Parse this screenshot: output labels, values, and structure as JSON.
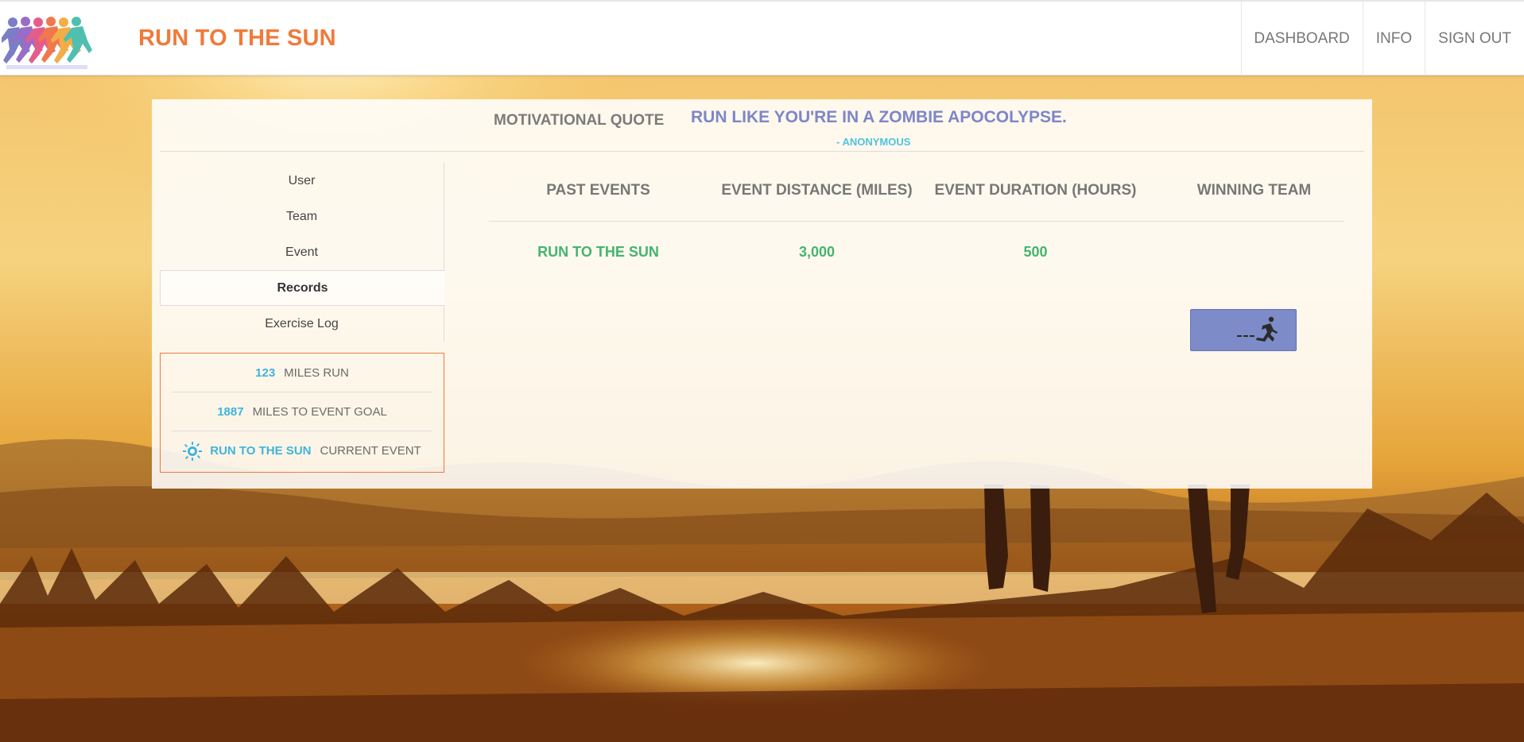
{
  "header": {
    "brand": "RUN TO THE SUN",
    "logo_icon": "runners-logo-icon",
    "nav": [
      "DASHBOARD",
      "INFO",
      "SIGN OUT"
    ]
  },
  "quote": {
    "label": "MOTIVATIONAL QUOTE",
    "text": "RUN LIKE YOU'RE IN A ZOMBIE APOCOLYPSE.",
    "author": "- ANONYMOUS"
  },
  "sidenav": {
    "items": [
      "User",
      "Team",
      "Event",
      "Records",
      "Exercise Log"
    ],
    "active": "Records"
  },
  "stats": {
    "miles_run": "123",
    "miles_run_label": "MILES RUN",
    "miles_to_goal": "1887",
    "miles_to_goal_label": "MILES TO EVENT GOAL",
    "current_event": "RUN TO THE SUN",
    "current_event_label": "CURRENT EVENT",
    "current_event_icon": "sun-icon"
  },
  "events_table": {
    "columns": [
      "PAST EVENTS",
      "EVENT DISTANCE (MILES)",
      "EVENT DURATION (HOURS)",
      "WINNING TEAM"
    ],
    "rows": [
      {
        "event": "RUN TO THE SUN",
        "distance": "3,000",
        "duration": "500",
        "team_icon": "running-man-icon"
      }
    ]
  },
  "colors": {
    "brand": "#f07a3b",
    "quote": "#7d86c8",
    "accent_blue": "#3fb4dd",
    "success_green": "#43b46e",
    "team_badge": "#7d8bc8"
  }
}
